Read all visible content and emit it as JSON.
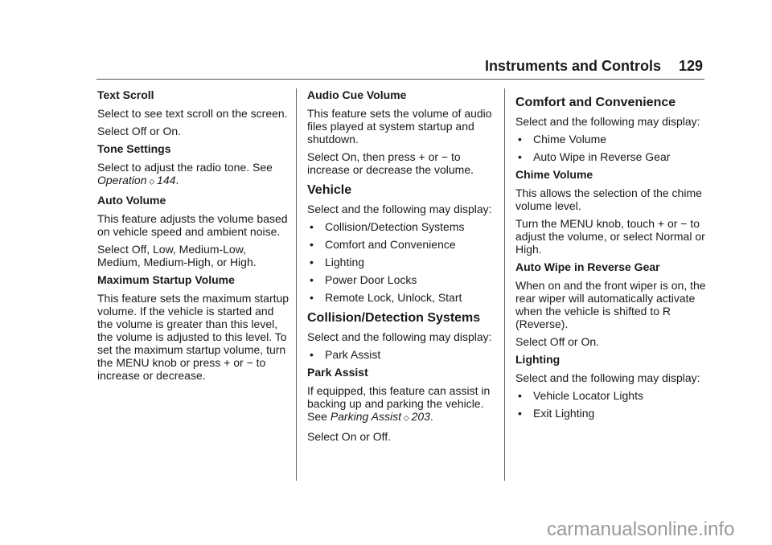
{
  "header": {
    "section": "Instruments and Controls",
    "page": "129"
  },
  "col1": [
    {
      "t": "h3",
      "text": "Text Scroll"
    },
    {
      "t": "p",
      "text": "Select to see text scroll on the screen."
    },
    {
      "t": "p",
      "text": "Select Off or On."
    },
    {
      "t": "h3",
      "text": "Tone Settings"
    },
    {
      "t": "ref",
      "text": "Select to adjust the radio tone. See ",
      "link": "Operation",
      "page": "144"
    },
    {
      "t": "h3",
      "text": "Auto Volume"
    },
    {
      "t": "p",
      "text": "This feature adjusts the volume based on vehicle speed and ambient noise."
    },
    {
      "t": "p",
      "text": "Select Off, Low, Medium-Low, Medium, Medium-High, or High."
    },
    {
      "t": "h3",
      "text": "Maximum Startup Volume"
    },
    {
      "t": "p",
      "text": "This feature sets the maximum startup volume. If the vehicle is started and the volume is greater than this level, the volume is adjusted to this level. To set the maximum startup volume, turn the MENU knob or press + or − to increase or decrease."
    }
  ],
  "col2": [
    {
      "t": "h3",
      "text": "Audio Cue Volume"
    },
    {
      "t": "p",
      "text": "This feature sets the volume of audio files played at system startup and shutdown."
    },
    {
      "t": "p",
      "text": "Select On, then press + or − to increase or decrease the volume."
    },
    {
      "t": "h2",
      "text": "Vehicle"
    },
    {
      "t": "p",
      "text": "Select and the following may display:"
    },
    {
      "t": "b",
      "text": "Collision/Detection Systems"
    },
    {
      "t": "b",
      "text": "Comfort and Convenience"
    },
    {
      "t": "b",
      "text": "Lighting"
    },
    {
      "t": "b",
      "text": "Power Door Locks"
    },
    {
      "t": "b",
      "text": "Remote Lock, Unlock, Start"
    },
    {
      "t": "h2",
      "text": "Collision/Detection Systems"
    },
    {
      "t": "p",
      "text": "Select and the following may display:"
    },
    {
      "t": "b",
      "text": "Park Assist"
    },
    {
      "t": "h3",
      "text": "Park Assist"
    },
    {
      "t": "ref",
      "text": "If equipped, this feature can assist in backing up and parking the vehicle. See ",
      "link": "Parking Assist",
      "page": "203"
    },
    {
      "t": "p",
      "text": "Select On or Off."
    }
  ],
  "col3": [
    {
      "t": "h2",
      "text": "Comfort and Convenience"
    },
    {
      "t": "p",
      "text": "Select and the following may display:"
    },
    {
      "t": "b",
      "text": "Chime Volume"
    },
    {
      "t": "b",
      "text": "Auto Wipe in Reverse Gear"
    },
    {
      "t": "h3",
      "text": "Chime Volume"
    },
    {
      "t": "p",
      "text": "This allows the selection of the chime volume level."
    },
    {
      "t": "p",
      "text": "Turn the MENU knob, touch + or − to adjust the volume, or select Normal or High."
    },
    {
      "t": "h3",
      "text": "Auto Wipe in Reverse Gear"
    },
    {
      "t": "p",
      "text": "When on and the front wiper is on, the rear wiper will automatically activate when the vehicle is shifted to R (Reverse)."
    },
    {
      "t": "p",
      "text": "Select Off or On."
    },
    {
      "t": "h3",
      "text": "Lighting"
    },
    {
      "t": "p",
      "text": "Select and the following may display:"
    },
    {
      "t": "b",
      "text": "Vehicle Locator Lights"
    },
    {
      "t": "b",
      "text": "Exit Lighting"
    }
  ],
  "watermark": "carmanualsonline.info"
}
